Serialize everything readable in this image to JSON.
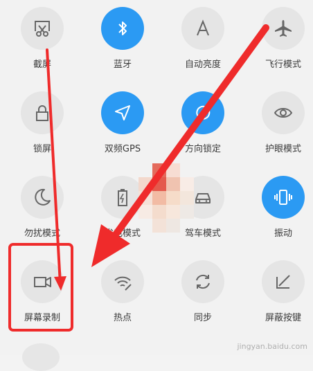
{
  "tiles": [
    {
      "label": "截屏",
      "icon": "screenshot-icon",
      "active": false
    },
    {
      "label": "蓝牙",
      "icon": "bluetooth-icon",
      "active": true
    },
    {
      "label": "自动亮度",
      "icon": "auto-brightness-icon",
      "active": false
    },
    {
      "label": "飞行模式",
      "icon": "airplane-icon",
      "active": false
    },
    {
      "label": "锁屏",
      "icon": "lock-icon",
      "active": false
    },
    {
      "label": "双频GPS",
      "icon": "gps-icon",
      "active": true
    },
    {
      "label": "方向锁定",
      "icon": "rotation-lock-icon",
      "active": true
    },
    {
      "label": "护眼模式",
      "icon": "eye-icon",
      "active": false
    },
    {
      "label": "勿扰模式",
      "icon": "moon-icon",
      "active": false
    },
    {
      "label": "省电模式",
      "icon": "battery-icon",
      "active": false
    },
    {
      "label": "驾车模式",
      "icon": "car-icon",
      "active": false
    },
    {
      "label": "振动",
      "icon": "vibrate-icon",
      "active": true
    },
    {
      "label": "屏幕录制",
      "icon": "screen-record-icon",
      "active": false
    },
    {
      "label": "热点",
      "icon": "hotspot-icon",
      "active": false
    },
    {
      "label": "同步",
      "icon": "sync-icon",
      "active": false
    },
    {
      "label": "屏蔽按键",
      "icon": "block-keys-icon",
      "active": false
    }
  ],
  "colors": {
    "active": "#2b9af3",
    "inactive": "#e5e5e5",
    "annotation": "#ef2b2b"
  },
  "watermark": "jingyan.baidu.com"
}
